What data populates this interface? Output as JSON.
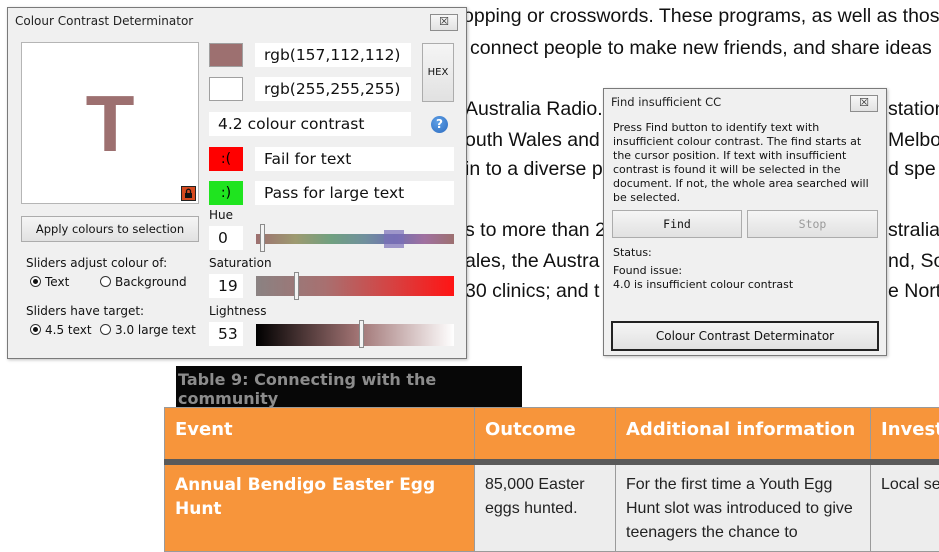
{
  "document": {
    "lines": [
      "opping or crosswords. These programs, as well as those",
      "connect people to make new friends, and share ideas",
      "Australia Radio.",
      "outh Wales and",
      "in to a diverse p",
      "s to more than 2",
      "ales, the Austra",
      "30 clinics; and t"
    ],
    "right_fragments": [
      "station",
      "Melbo",
      "d spe",
      "stralia",
      "nd, So",
      "e Nort"
    ],
    "table_caption": "Table 9: Connecting with the community",
    "table_headers": [
      "Event",
      "Outcome",
      "Additional information",
      "Investr"
    ],
    "table_row": [
      "Annual Bendigo Easter Egg Hunt",
      "85,000 Easter eggs hunted.",
      "For the first time a Youth Egg Hunt slot was introduced to give teenagers the chance to",
      "Local se"
    ]
  },
  "ccd": {
    "title": "Colour Contrast Determinator",
    "close_label": "☒",
    "preview_letter": "T",
    "foreground": "rgb(157,112,112)",
    "background": "rgb(255,255,255)",
    "hex_label": "HEX",
    "contrast_text": "4.2 colour contrast",
    "info_label": "?",
    "fail_icon": ":(",
    "fail_text": "Fail for text",
    "pass_icon": ":)",
    "pass_text": "Pass for large text",
    "apply_button": "Apply colours to selection",
    "adjust_label": "Sliders adjust colour of:",
    "adjust_text": "Text",
    "adjust_background": "Background",
    "target_label": "Sliders have target:",
    "target_45": "4.5 text",
    "target_30": "3.0 large text",
    "hue_label": "Hue",
    "hue_value": "0",
    "saturation_label": "Saturation",
    "saturation_value": "19",
    "lightness_label": "Lightness",
    "lightness_value": "53",
    "colors": {
      "foreground": "#9d7070",
      "background": "#ffffff",
      "fail": "#ff0000",
      "pass": "#1fe41f",
      "lock": "#d64a1f"
    }
  },
  "find": {
    "title": "Find insufficient CC",
    "close_label": "☒",
    "instructions": [
      "Press Find button to identify text with",
      "insufficient colour contrast. The find starts at",
      "the cursor position. If text with insufficient",
      "contrast is found it will be selected in the",
      "document. If not, the whole area searched will",
      "be selected."
    ],
    "find_button": "Find",
    "stop_button": "Stop",
    "status_label": "Status:",
    "found_label": "Found issue:",
    "found_detail": "4.0 is insufficient colour contrast",
    "ccd_button": "Colour Contrast Determinator"
  }
}
